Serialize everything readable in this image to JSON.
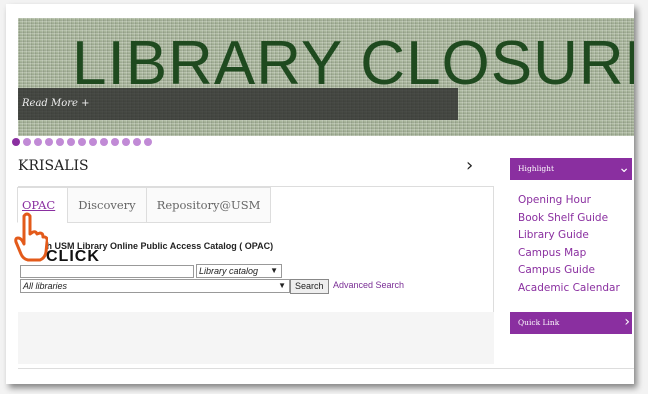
{
  "banner": {
    "title": "LIBRARY CLOSURE",
    "read_more": "Read More +"
  },
  "slider": {
    "dot_count": 13,
    "active_index": 0
  },
  "section": {
    "title": "KRISALIS",
    "next_arrow": "›"
  },
  "tabs": [
    {
      "label": "OPAC",
      "active": true
    },
    {
      "label": "Discovery",
      "active": false
    },
    {
      "label": "Repository@USM",
      "active": false
    }
  ],
  "opac": {
    "heading": "Search USM Library Online Public Access Catalog ( OPAC)",
    "search_value": "",
    "catalog_select": "Library catalog",
    "libraries_select": "All libraries",
    "search_button": "Search",
    "advanced_link": "Advanced Search"
  },
  "overlay": {
    "click_label": "CLICK"
  },
  "sidebar": {
    "highlight_title": "Highlight",
    "links": [
      "Opening Hour",
      "Book Shelf Guide",
      "Library Guide",
      "Campus Map",
      "Campus Guide",
      "Academic Calendar"
    ],
    "quick_link_title": "Quick Link"
  },
  "colors": {
    "accent": "#8a2fa0",
    "banner_text": "#1f4a1f"
  }
}
